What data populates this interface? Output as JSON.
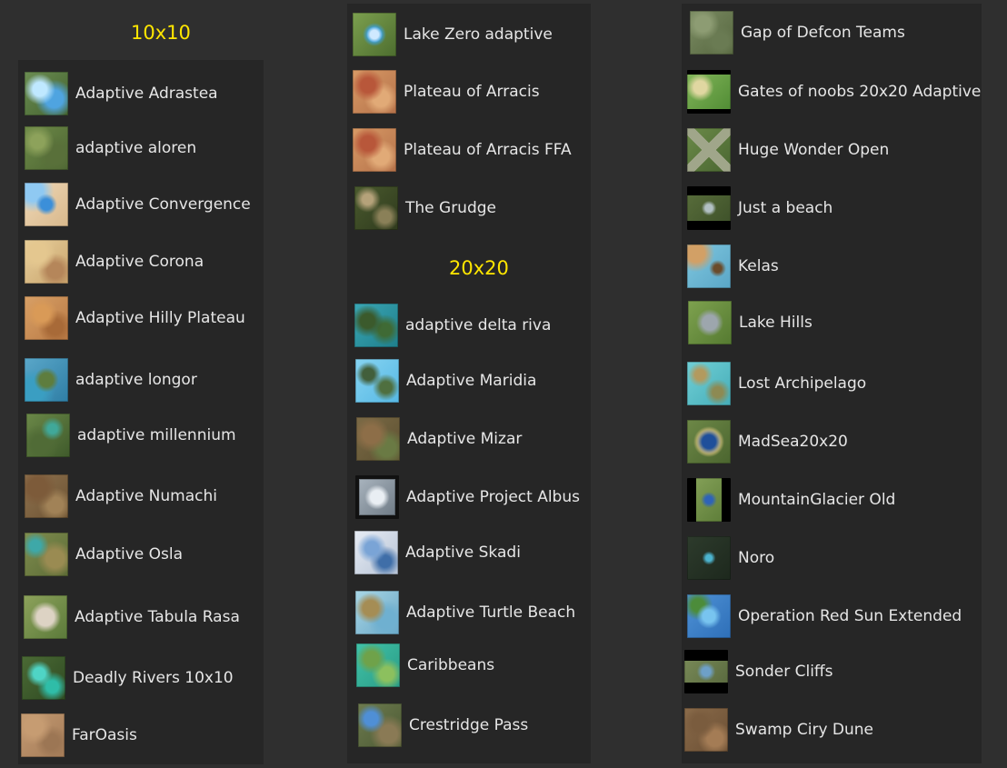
{
  "headings": {
    "h10": "10x10",
    "h20": "20x20"
  },
  "col1": [
    {
      "label": "Adaptive Adrastea",
      "icon": "adrastea-map-icon"
    },
    {
      "label": "adaptive aloren",
      "icon": "aloren-map-icon"
    },
    {
      "label": "Adaptive Convergence",
      "icon": "convergence-map-icon"
    },
    {
      "label": "Adaptive Corona",
      "icon": "corona-map-icon"
    },
    {
      "label": "Adaptive Hilly Plateau",
      "icon": "hilly-plateau-map-icon"
    },
    {
      "label": "adaptive longor",
      "icon": "longor-map-icon"
    },
    {
      "label": "adaptive millennium",
      "icon": "millennium-map-icon"
    },
    {
      "label": "Adaptive Numachi",
      "icon": "numachi-map-icon"
    },
    {
      "label": "Adaptive Osla",
      "icon": "osla-map-icon"
    },
    {
      "label": "Adaptive Tabula Rasa",
      "icon": "tabula-rasa-map-icon"
    },
    {
      "label": "Deadly Rivers 10x10",
      "icon": "deadly-rivers-map-icon"
    },
    {
      "label": "FarOasis",
      "icon": "faroasis-map-icon"
    }
  ],
  "col2a": [
    {
      "label": "Lake Zero adaptive",
      "icon": "lake-zero-map-icon"
    },
    {
      "label": "Plateau of Arracis",
      "icon": "arracis-map-icon"
    },
    {
      "label": "Plateau of Arracis FFA",
      "icon": "arracis-ffa-map-icon"
    },
    {
      "label": "The Grudge",
      "icon": "grudge-map-icon"
    }
  ],
  "col2b": [
    {
      "label": "adaptive delta riva",
      "icon": "delta-riva-map-icon"
    },
    {
      "label": "Adaptive Maridia",
      "icon": "maridia-map-icon"
    },
    {
      "label": "Adaptive Mizar",
      "icon": "mizar-map-icon"
    },
    {
      "label": "Adaptive Project Albus",
      "icon": "project-albus-map-icon"
    },
    {
      "label": "Adaptive Skadi",
      "icon": "skadi-map-icon"
    },
    {
      "label": "Adaptive Turtle Beach",
      "icon": "turtle-beach-map-icon"
    },
    {
      "label": "Caribbeans",
      "icon": "caribbeans-map-icon"
    },
    {
      "label": "Crestridge Pass",
      "icon": "crestridge-map-icon"
    }
  ],
  "col3": [
    {
      "label": "Gap of Defcon Teams",
      "icon": "gap-defcon-map-icon"
    },
    {
      "label": "Gates of noobs 20x20 Adaptive",
      "icon": "gates-noobs-map-icon"
    },
    {
      "label": "Huge Wonder Open",
      "icon": "huge-wonder-map-icon"
    },
    {
      "label": "Just a beach",
      "icon": "just-a-beach-map-icon"
    },
    {
      "label": "Kelas",
      "icon": "kelas-map-icon"
    },
    {
      "label": "Lake Hills",
      "icon": "lake-hills-map-icon"
    },
    {
      "label": "Lost Archipelago",
      "icon": "lost-archipelago-map-icon"
    },
    {
      "label": "MadSea20x20",
      "icon": "madsea-map-icon"
    },
    {
      "label": "MountainGlacier Old",
      "icon": "mountain-glacier-map-icon"
    },
    {
      "label": "Noro",
      "icon": "noro-map-icon"
    },
    {
      "label": "Operation Red Sun Extended",
      "icon": "red-sun-map-icon"
    },
    {
      "label": "Sonder Cliffs",
      "icon": "sonder-cliffs-map-icon"
    },
    {
      "label": "Swamp Ciry Dune",
      "icon": "swamp-dune-map-icon"
    }
  ]
}
